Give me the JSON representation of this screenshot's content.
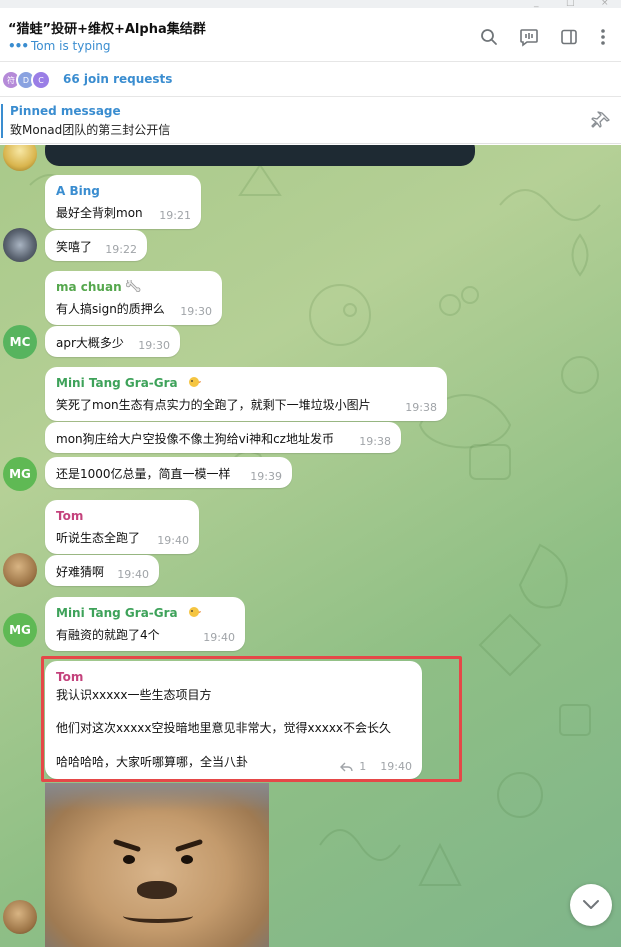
{
  "header": {
    "title": "“猎蛙”投研+维权+Alpha集结群",
    "status_dots": "•••",
    "status": "Tom is typing"
  },
  "join_requests": {
    "label": "66 join requests",
    "avatars": [
      "符",
      "D",
      "C"
    ]
  },
  "pinned": {
    "title": "Pinned message",
    "text": "致Monad团队的第三封公开信"
  },
  "messages": [
    {
      "sender": "A Bing",
      "text": "最好全背刺mon",
      "time": "19:21"
    },
    {
      "text": "笑嘻了",
      "time": "19:22"
    },
    {
      "sender": "ma chuan",
      "text": "有人搞sign的质押么",
      "time": "19:30"
    },
    {
      "text": "apr大概多少",
      "time": "19:30",
      "avatar": "MC"
    },
    {
      "sender": "Mini Tang Gra-Gra",
      "text": "笑死了mon生态有点实力的全跑了，就剩下一堆垃圾小图片",
      "time": "19:38"
    },
    {
      "text": "mon狗庄给大户空投像不像土狗给vi神和cz地址发币",
      "time": "19:38"
    },
    {
      "text": "还是1000亿总量，简直一模一样",
      "time": "19:39",
      "avatar": "MG"
    },
    {
      "sender": "Tom",
      "text": "听说生态全跑了",
      "time": "19:40"
    },
    {
      "text": "好难猜啊",
      "time": "19:40"
    },
    {
      "sender": "Mini Tang Gra-Gra",
      "text": "有融资的就跑了4个",
      "time": "19:40",
      "avatar": "MG"
    },
    {
      "sender": "Tom",
      "lines": [
        "我认识xxxxx一些生态项目方",
        "他们对这次xxxxx空投暗地里意见非常大，觉得xxxxx不会长久",
        "哈哈哈哈，大家听哪算哪，全当八卦"
      ],
      "replies": "1",
      "time": "19:40"
    }
  ],
  "colors": {
    "accent": "#3a8dd0",
    "name_tom": "#c4427c",
    "name_green": "#3ea25a",
    "highlight": "#e54848"
  },
  "icons": [
    "search-icon",
    "video-chat-icon",
    "sidebar-toggle-icon",
    "more-vert-icon",
    "unpin-icon",
    "reply-icon",
    "scroll-down-icon"
  ]
}
